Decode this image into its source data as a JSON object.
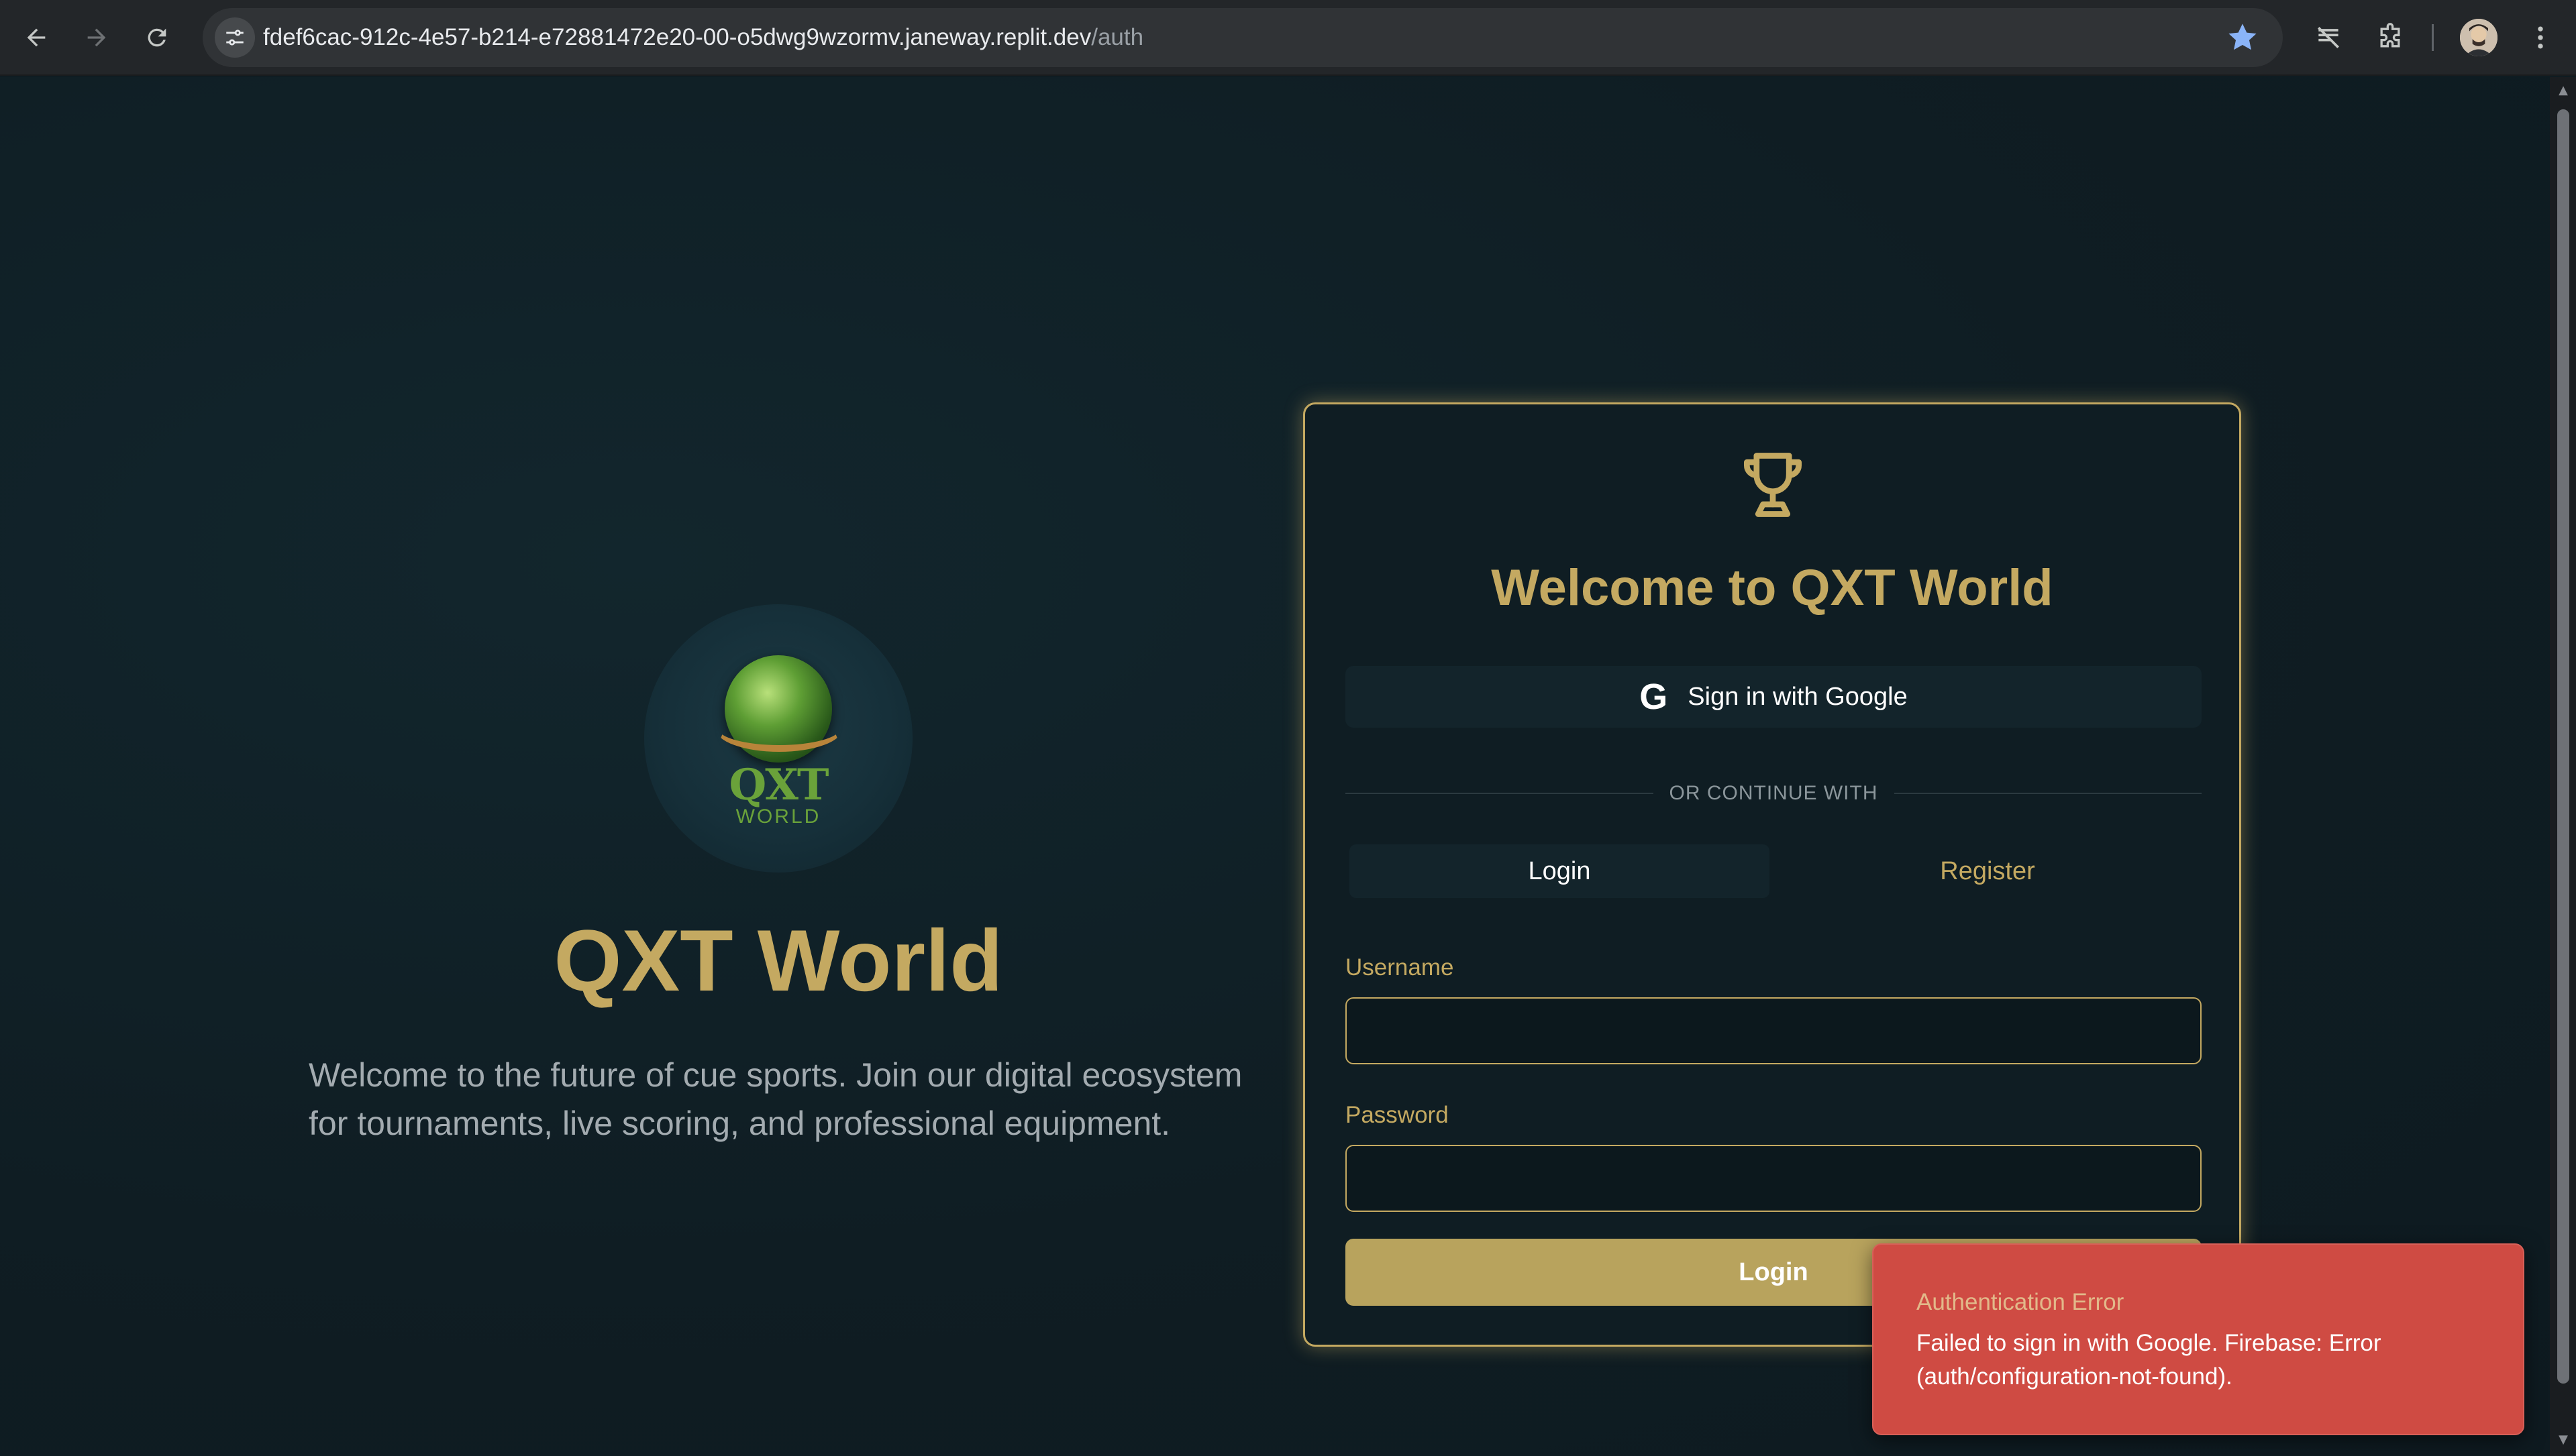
{
  "browser": {
    "url_host": "fdef6cac-912c-4e57-b214-e72881472e20-00-o5dwg9wzormv.janeway.replit.dev",
    "url_path": "/auth"
  },
  "hero": {
    "logo_text": "QXT",
    "logo_subtext": "WORLD",
    "title": "QXT World",
    "description": "Welcome to the future of cue sports. Join our digital ecosystem for tournaments, live scoring, and professional equipment."
  },
  "auth_card": {
    "title": "Welcome to QXT World",
    "google_button_label": "Sign in with Google",
    "google_glyph": "G",
    "divider_text": "OR CONTINUE WITH",
    "tabs": [
      {
        "label": "Login",
        "active": true
      },
      {
        "label": "Register",
        "active": false
      }
    ],
    "username_label": "Username",
    "username_value": "",
    "password_label": "Password",
    "password_value": "",
    "submit_label": "Login"
  },
  "toast": {
    "title": "Authentication Error",
    "message": "Failed to sign in with Google. Firebase: Error (auth/configuration-not-found)."
  },
  "colors": {
    "accent_gold": "#c4a961",
    "page_bg": "#0f1c22",
    "error_red": "#cf4b43"
  }
}
